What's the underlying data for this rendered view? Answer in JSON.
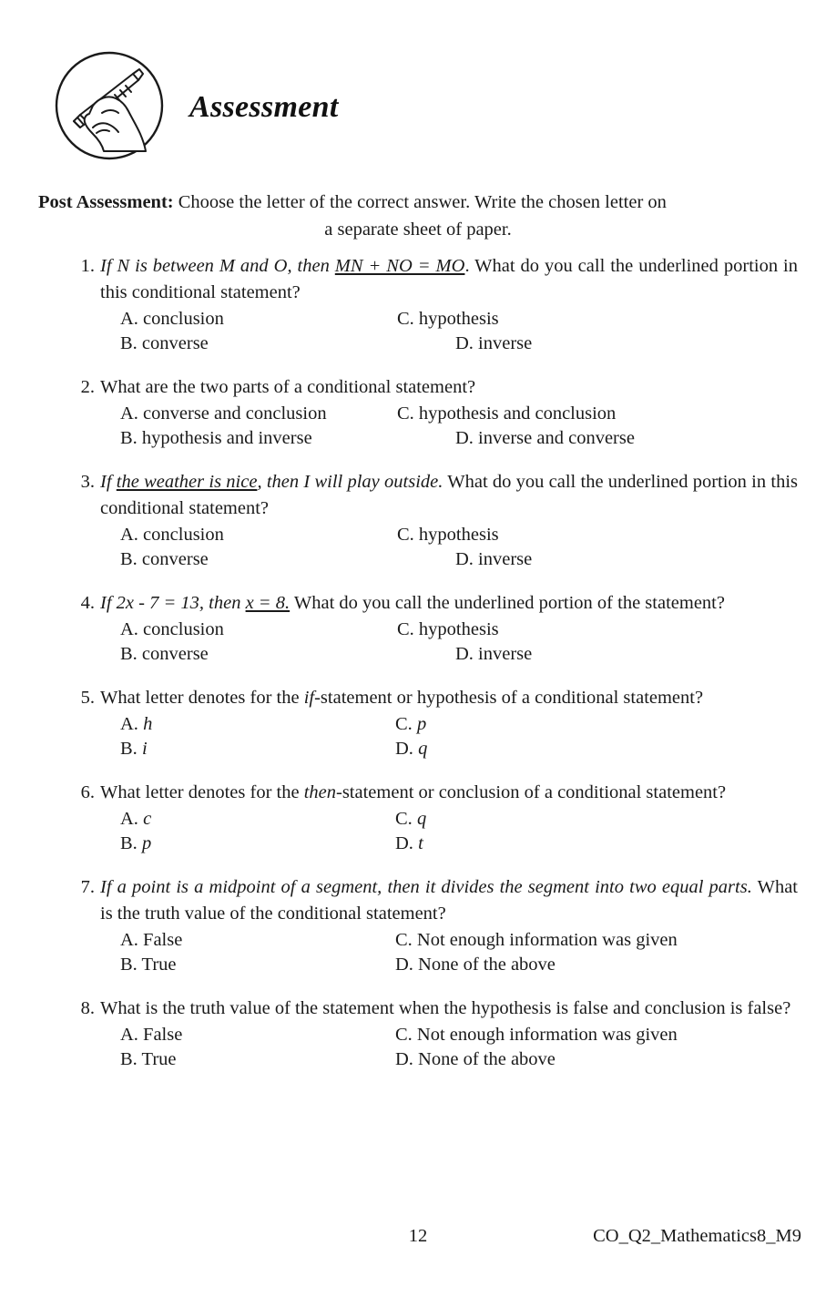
{
  "header": {
    "icon": "hand-writing-pencil-icon",
    "title": "Assessment"
  },
  "intro": {
    "label": "Post Assessment:",
    "line1": " Choose the letter of the correct answer. Write the chosen letter on",
    "line2": "a separate sheet of paper."
  },
  "questions": [
    {
      "number": "1.",
      "text_parts": [
        {
          "text": "If N is between M and O, then ",
          "style": "italic"
        },
        {
          "text": "MN + NO = MO",
          "style": "italic-underline"
        },
        {
          "text": ". What do you call the underlined portion in this conditional statement?",
          "style": "normal"
        }
      ],
      "options": {
        "a": "A. conclusion",
        "b": "B. converse",
        "c": "C. hypothesis",
        "d": "D. inverse"
      },
      "right_column": "staggered",
      "justify": true
    },
    {
      "number": "2.",
      "text_parts": [
        {
          "text": "What are the two parts of a conditional statement?",
          "style": "normal"
        }
      ],
      "options": {
        "a": "A. converse and conclusion",
        "b": "B. hypothesis and inverse",
        "c": "C. hypothesis and conclusion",
        "d": "D. inverse and converse"
      },
      "right_column": "staggered",
      "justify": false
    },
    {
      "number": "3.",
      "text_parts": [
        {
          "text": "If ",
          "style": "italic"
        },
        {
          "text": "the weather is nice",
          "style": "italic-underline"
        },
        {
          "text": ", then I will play outside.",
          "style": "italic"
        },
        {
          "text": " What do you call the underlined portion in this conditional statement?",
          "style": "normal"
        }
      ],
      "options": {
        "a": "A. conclusion",
        "b": "B. converse",
        "c": "C. hypothesis",
        "d": "D. inverse"
      },
      "right_column": "staggered",
      "justify": true
    },
    {
      "number": "4.",
      "text_parts": [
        {
          "text": "If 2x - 7 = 13, then ",
          "style": "italic"
        },
        {
          "text": "x = 8.",
          "style": "italic-underline"
        },
        {
          "text": " What do you call the underlined portion of the statement?",
          "style": "normal"
        }
      ],
      "options": {
        "a": "A. conclusion",
        "b": "B. converse",
        "c": "C. hypothesis",
        "d": "D. inverse"
      },
      "right_column": "staggered",
      "justify": true
    },
    {
      "number": "5.",
      "text_parts": [
        {
          "text": "What letter denotes for the ",
          "style": "normal"
        },
        {
          "text": "if",
          "style": "italic"
        },
        {
          "text": "-statement or hypothesis of a conditional statement?",
          "style": "normal"
        }
      ],
      "options": {
        "a": "A. h",
        "b": "B. i",
        "c": "C. p",
        "d": "D. q"
      },
      "option_italic_value": true,
      "right_column": "aligned",
      "justify": true
    },
    {
      "number": "6.",
      "text_parts": [
        {
          "text": "What letter denotes for the ",
          "style": "normal"
        },
        {
          "text": "then",
          "style": "italic"
        },
        {
          "text": "-statement or conclusion of a conditional statement?",
          "style": "normal"
        }
      ],
      "options": {
        "a": "A. c",
        "b": "B. p",
        "c": "C. q",
        "d": "D. t"
      },
      "option_italic_value": true,
      "right_column": "aligned",
      "justify": true
    },
    {
      "number": "7.",
      "text_parts": [
        {
          "text": "If a point is a midpoint of a segment, then it divides the segment into two equal parts.",
          "style": "italic"
        },
        {
          "text": " What is the truth value of the conditional statement?",
          "style": "normal"
        }
      ],
      "options": {
        "a": "A. False",
        "b": "B. True",
        "c": "C. Not enough information was given",
        "d": "D. None of the above"
      },
      "right_column": "aligned",
      "justify": true
    },
    {
      "number": "8.",
      "text_parts": [
        {
          "text": "What is the truth value of the statement when the hypothesis is false and conclusion is false?",
          "style": "normal"
        }
      ],
      "options": {
        "a": "A. False",
        "b": "B. True",
        "c": "C. Not enough information was given",
        "d": "D. None of the above"
      },
      "right_column": "aligned",
      "justify": true
    }
  ],
  "footer": {
    "page_number": "12",
    "document_code": "CO_Q2_Mathematics8_M9"
  }
}
